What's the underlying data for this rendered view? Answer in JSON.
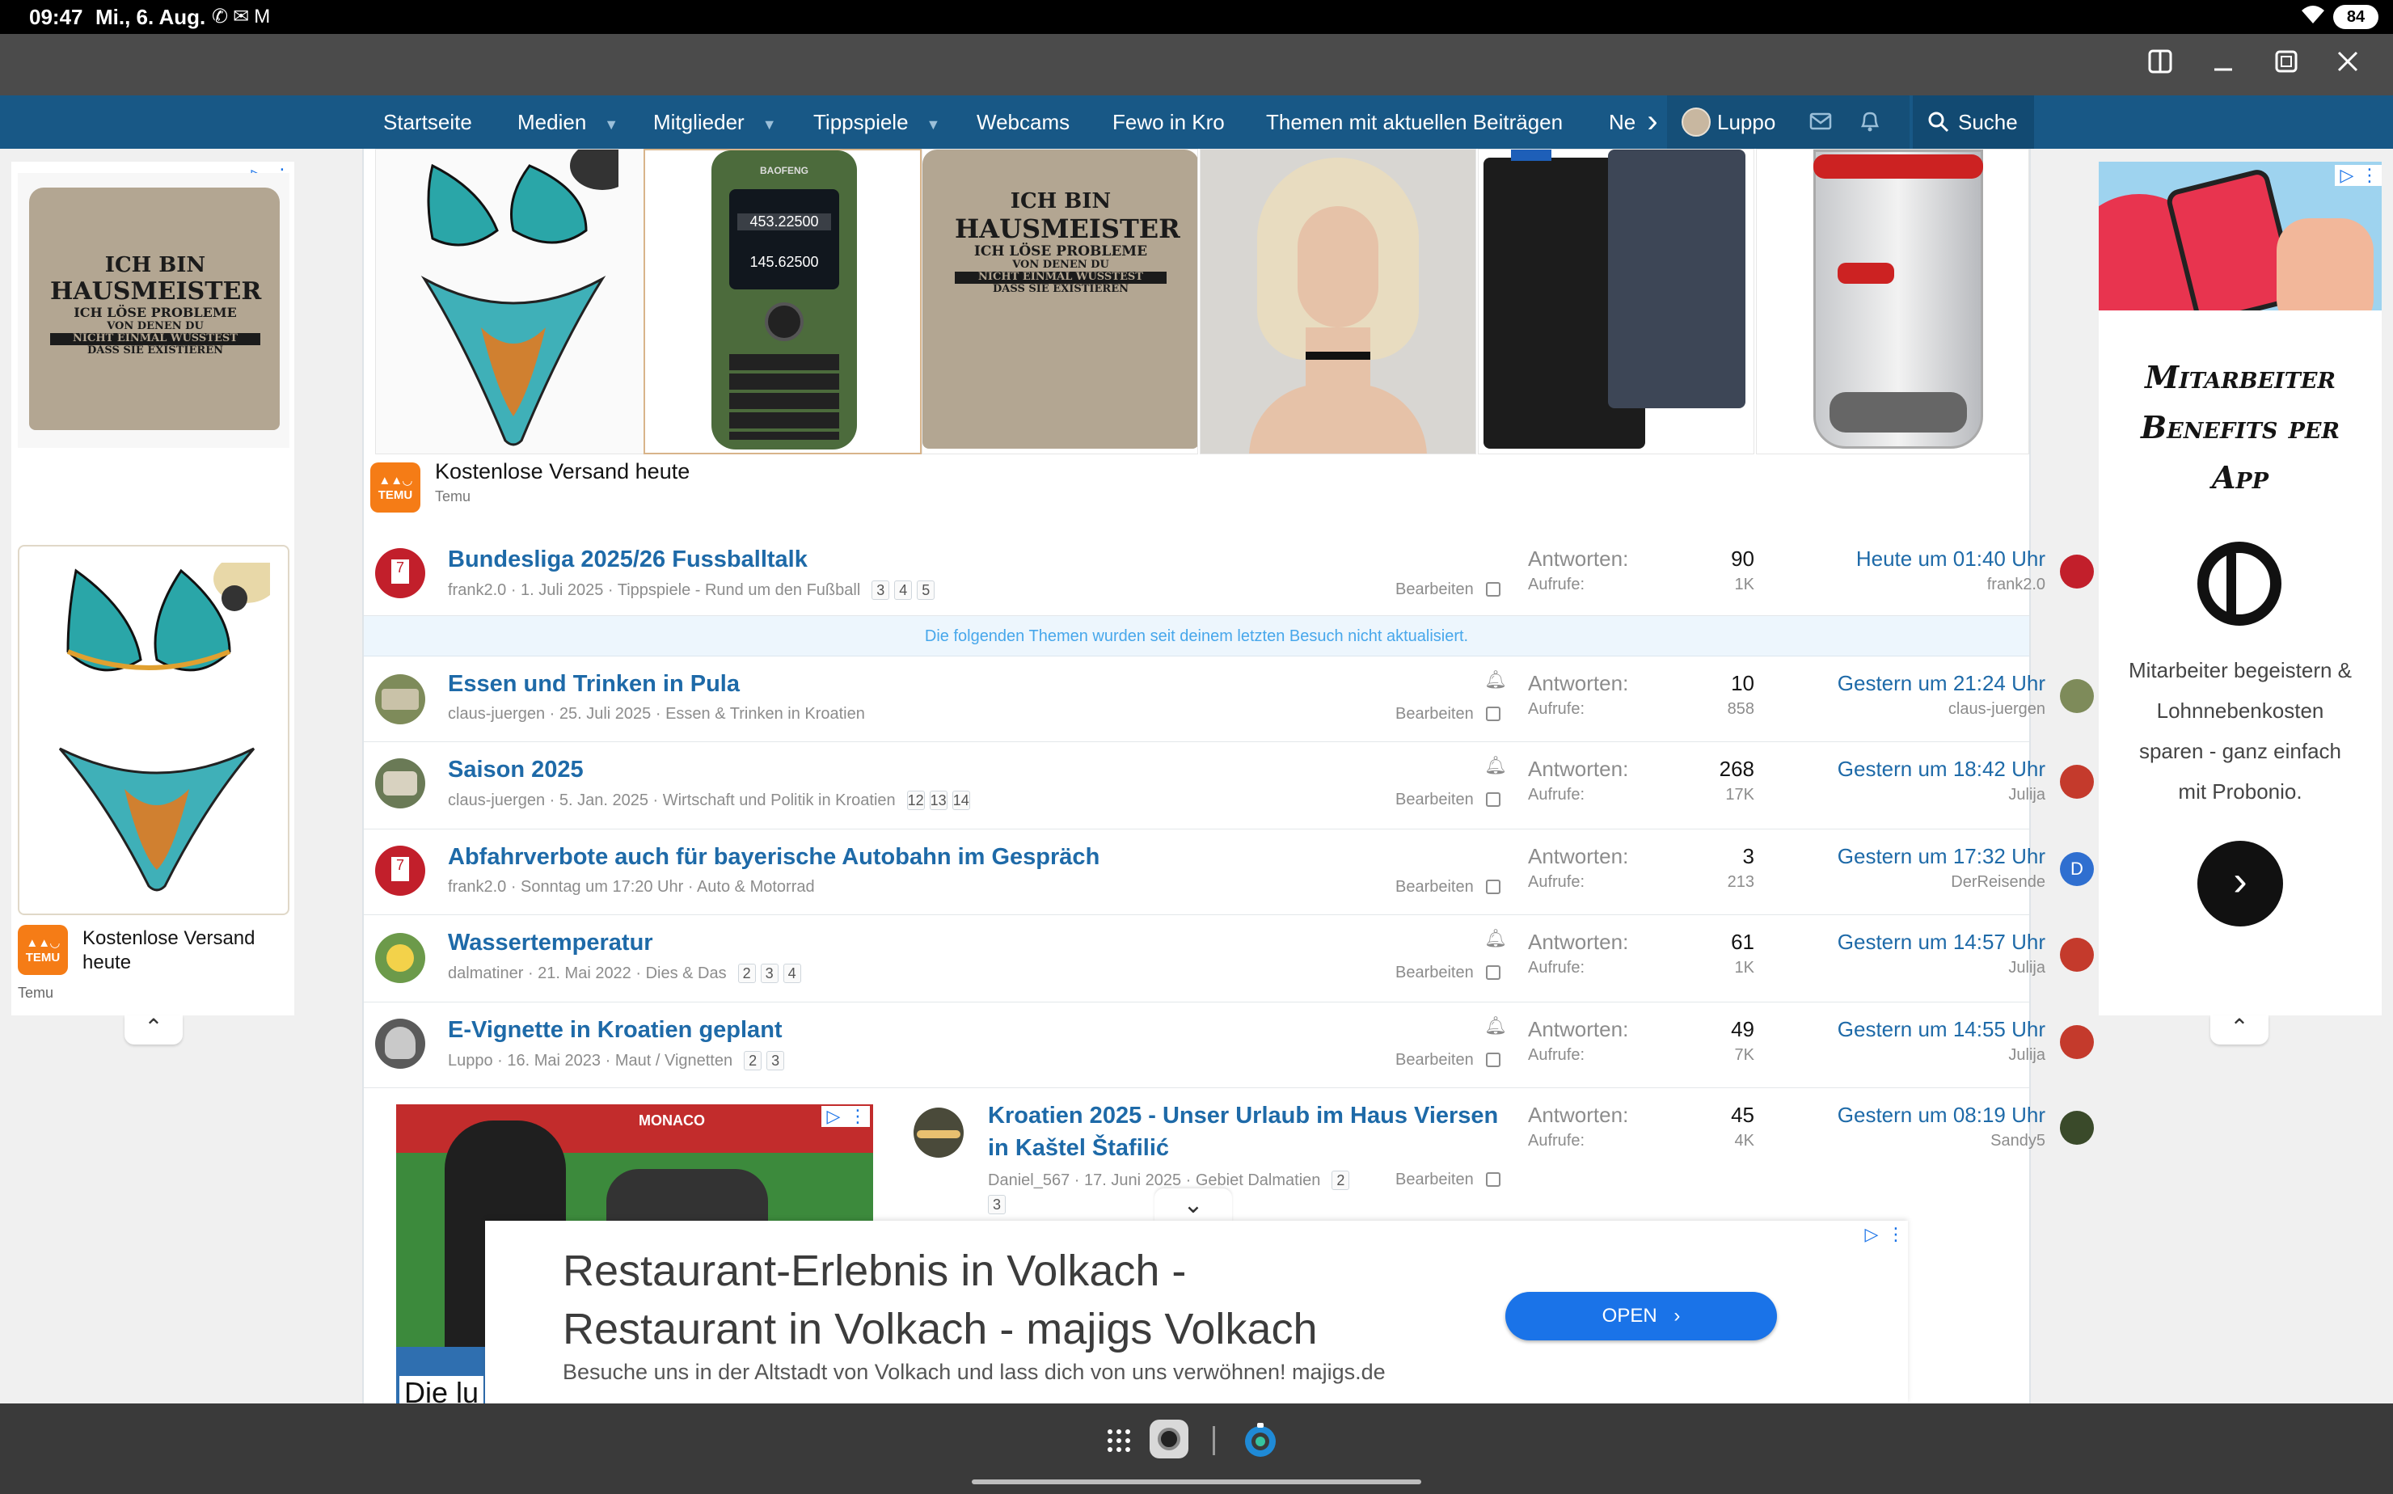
{
  "statusbar": {
    "time": "09:47",
    "date": "Mi., 6. Aug.",
    "battery": "84"
  },
  "nav": {
    "items": [
      "Startseite",
      "Medien",
      "Mitglieder",
      "Tippspiele",
      "Webcams",
      "Fewo in Kro",
      "Themen mit aktuellen Beiträgen",
      "Ne"
    ],
    "user": "Luppo",
    "search": "Suche"
  },
  "ad_left": {
    "shirt_lines": [
      "ICH BIN",
      "HAUSMEISTER",
      "ICH LÖSE PROBLEME",
      "VON DENEN DU",
      "NICHT EINMAL WUSSTEST",
      "DASS SIE EXISTIEREN"
    ],
    "caption": "Kostenlose Versand heute",
    "source": "Temu"
  },
  "ad_top": {
    "radio": {
      "brand": "BAOFENG",
      "freq1": "453.22500",
      "freq2": "145.62500"
    },
    "shirt_lines": [
      "ICH BIN",
      "HAUSMEISTER",
      "ICH LÖSE PROBLEME",
      "VON DENEN DU",
      "NICHT EINMAL WUSSTEST",
      "DASS SIE EXISTIEREN"
    ],
    "caption": "Kostenlose Versand heute",
    "source": "Temu"
  },
  "ad_right": {
    "headline": "Mitarbeiter Benefits per App",
    "body": "Mitarbeiter begeistern & Lohnnebenkosten sparen - ganz einfach mit Probonio."
  },
  "labels": {
    "replies": "Antworten:",
    "views": "Aufrufe:",
    "edit": "Bearbeiten"
  },
  "notice": "Die folgenden Themen wurden seit deinem letzten Besuch nicht aktualisiert.",
  "threads": [
    {
      "title": "Bundesliga 2025/26 Fussballtalk",
      "author": "frank2.0",
      "date": "1. Juli 2025",
      "forum": "Tippspiele - Rund um den Fußball",
      "pages": [
        "3",
        "4",
        "5"
      ],
      "replies": "90",
      "views": "1K",
      "last_time": "Heute um 01:40 Uhr",
      "last_user": "frank2.0"
    },
    {
      "title": "Essen und Trinken in Pula",
      "author": "claus-juergen",
      "date": "25. Juli 2025",
      "forum": "Essen & Trinken in Kroatien",
      "pages": [],
      "replies": "10",
      "views": "858",
      "last_time": "Gestern um 21:24 Uhr",
      "last_user": "claus-juergen"
    },
    {
      "title": "Saison 2025",
      "author": "claus-juergen",
      "date": "5. Jan. 2025",
      "forum": "Wirtschaft und Politik in Kroatien",
      "pages": [
        "12",
        "13",
        "14"
      ],
      "replies": "268",
      "views": "17K",
      "last_time": "Gestern um 18:42 Uhr",
      "last_user": "Julija"
    },
    {
      "title": "Abfahrverbote auch für bayerische Autobahn im Gespräch",
      "author": "frank2.0",
      "date": "Sonntag um 17:20 Uhr",
      "forum": "Auto & Motorrad",
      "pages": [],
      "replies": "3",
      "views": "213",
      "last_time": "Gestern um 17:32 Uhr",
      "last_user": "DerReisende"
    },
    {
      "title": "Wassertemperatur",
      "author": "dalmatiner",
      "date": "21. Mai 2022",
      "forum": "Dies & Das",
      "pages": [
        "2",
        "3",
        "4"
      ],
      "replies": "61",
      "views": "1K",
      "last_time": "Gestern um 14:57 Uhr",
      "last_user": "Julija"
    },
    {
      "title": "E-Vignette in Kroatien geplant",
      "author": "Luppo",
      "date": "16. Mai 2023",
      "forum": "Maut / Vignetten",
      "pages": [
        "2",
        "3"
      ],
      "replies": "49",
      "views": "7K",
      "last_time": "Gestern um 14:55 Uhr",
      "last_user": "Julija"
    },
    {
      "title_line1": "Kroatien 2025 - Unser Urlaub im Haus Viersen",
      "title_line2": "in Kaštel Štafilić",
      "author": "Daniel_567",
      "date": "17. Juni 2025",
      "forum": "Gebiet Dalmatien",
      "pages": [
        "2",
        "3"
      ],
      "replies": "45",
      "views": "4K",
      "last_time": "Gestern um 08:19 Uhr",
      "last_user": "Sandy5"
    }
  ],
  "video_ad": {
    "caption": "Die lu",
    "banner": "MONACO"
  },
  "bottom_ad": {
    "headline_line1": "Restaurant-Erlebnis in Volkach -",
    "headline_line2": "Restaurant in Volkach - majigs Volkach",
    "description": "Besuche uns in der Altstadt von Volkach und lass dich von uns verwöhnen! majigs.de",
    "cta": "OPEN"
  },
  "derreisende_initial": "D",
  "colors": {
    "nav": "#185886",
    "link": "#1e6aa8",
    "temu": "#f57c16",
    "ad_button": "#1a73e8",
    "probonio_pink": "#e8344f"
  },
  "icons": [
    "whatsapp-icon",
    "mail-icon",
    "gmail-icon",
    "wifi-icon",
    "window-split-icon",
    "minimize-icon",
    "maximize-icon",
    "close-icon",
    "caret-icon",
    "chevron-right-icon",
    "envelope-icon",
    "bell-icon",
    "search-icon",
    "ad-choices-icon",
    "menu-dots-icon",
    "checkbox-icon",
    "chevron-up-icon",
    "chevron-down-icon",
    "apps-grid-icon",
    "camera-app-icon",
    "edge-browser-icon"
  ]
}
